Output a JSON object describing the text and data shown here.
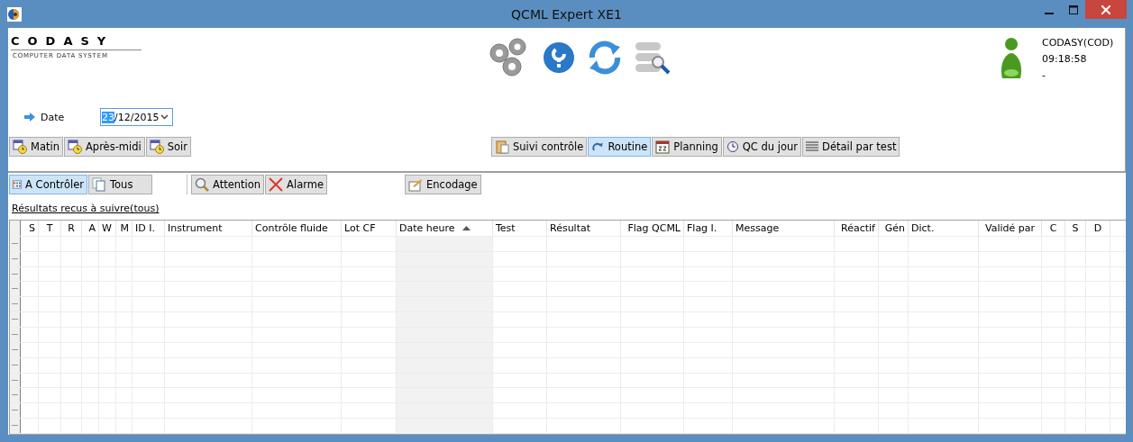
{
  "window": {
    "title": "QCML Expert XE1"
  },
  "logo": {
    "name": "CODASY",
    "tagline": "COMPUTER DATA SYSTEM"
  },
  "user": {
    "name": "CODASY(COD)",
    "time": "09:18:58",
    "status": "-"
  },
  "date": {
    "label": "Date",
    "segments": [
      {
        "text": "23",
        "selected": true
      },
      {
        "text": "/12/2015",
        "selected": false
      }
    ]
  },
  "shift_buttons": [
    {
      "label": "Matin"
    },
    {
      "label": "Après-midi"
    },
    {
      "label": "Soir"
    }
  ],
  "view_buttons": [
    {
      "label": "Suivi contrôle",
      "selected": false
    },
    {
      "label": "Routine",
      "selected": true
    },
    {
      "label": "Planning",
      "selected": false
    },
    {
      "label": "QC du jour",
      "selected": false
    },
    {
      "label": "Détail par test",
      "selected": false
    }
  ],
  "filter_tabs": [
    {
      "label": "A Contrôler",
      "selected": true
    },
    {
      "label": "Tous",
      "selected": false
    }
  ],
  "alert_buttons": [
    {
      "label": "Attention"
    },
    {
      "label": "Alarme"
    }
  ],
  "encode_button": {
    "label": "Encodage"
  },
  "link": "Résultats recus à suivre(tous)",
  "table": {
    "columns": [
      {
        "label": "S",
        "sorted": false
      },
      {
        "label": "T",
        "sorted": false
      },
      {
        "label": "R",
        "sorted": false
      },
      {
        "label": "A",
        "sorted": false
      },
      {
        "label": "W",
        "sorted": false
      },
      {
        "label": "M",
        "sorted": false
      },
      {
        "label": "ID I.",
        "sorted": false
      },
      {
        "label": "Instrument",
        "sorted": false
      },
      {
        "label": "Contrôle fluide",
        "sorted": false
      },
      {
        "label": "Lot CF",
        "sorted": false
      },
      {
        "label": "Date heure",
        "sorted": true
      },
      {
        "label": "Test",
        "sorted": false
      },
      {
        "label": "Résultat",
        "sorted": false
      },
      {
        "label": "Flag QCML",
        "sorted": false
      },
      {
        "label": "Flag I.",
        "sorted": false
      },
      {
        "label": "Message",
        "sorted": false
      },
      {
        "label": "Réactif",
        "sorted": false
      },
      {
        "label": "Gén",
        "sorted": false
      },
      {
        "label": "Dict.",
        "sorted": false
      },
      {
        "label": "Validé par",
        "sorted": false
      },
      {
        "label": "C",
        "sorted": false
      },
      {
        "label": "S",
        "sorted": false
      },
      {
        "label": "D",
        "sorted": false
      }
    ]
  }
}
